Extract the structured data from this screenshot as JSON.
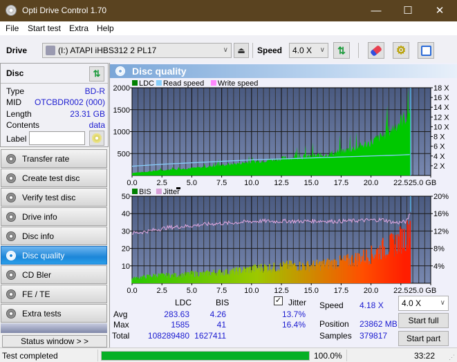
{
  "window": {
    "title": "Opti Drive Control 1.70",
    "minimize": "—",
    "maximize": "☐",
    "close": "✕"
  },
  "menu": [
    "File",
    "Start test",
    "Extra",
    "Help"
  ],
  "toolbar": {
    "drive_label": "Drive",
    "drive_value": "(I:)  ATAPI iHBS312   2 PL17",
    "speed_label": "Speed",
    "speed_value": "4.0 X"
  },
  "disc": {
    "header": "Disc",
    "rows": [
      {
        "key": "Type",
        "value": "BD-R"
      },
      {
        "key": "MID",
        "value": "OTCBDR002 (000)"
      },
      {
        "key": "Length",
        "value": "23.31 GB"
      },
      {
        "key": "Contents",
        "value": "data"
      }
    ],
    "label_key": "Label",
    "label_value": ""
  },
  "nav": [
    {
      "label": "Transfer rate",
      "active": false
    },
    {
      "label": "Create test disc",
      "active": false
    },
    {
      "label": "Verify test disc",
      "active": false
    },
    {
      "label": "Drive info",
      "active": false
    },
    {
      "label": "Disc info",
      "active": false
    },
    {
      "label": "Disc quality",
      "active": true
    },
    {
      "label": "CD Bler",
      "active": false
    },
    {
      "label": "FE / TE",
      "active": false
    },
    {
      "label": "Extra tests",
      "active": false
    }
  ],
  "status_window_label": "Status window > >",
  "panel_title": "Disc quality",
  "chart_data": [
    {
      "type": "area",
      "title": "",
      "legend": [
        "LDC",
        "Read speed",
        "Write speed"
      ],
      "legend_colors": [
        "#008000",
        "#87cefa",
        "#ff88ff"
      ],
      "legend_position": "top-left",
      "xlabel": "GB",
      "xlim": [
        0,
        25
      ],
      "xticks": [
        "0.0",
        "2.5",
        "5.0",
        "7.5",
        "10.0",
        "12.5",
        "15.0",
        "17.5",
        "20.0",
        "22.5",
        "25.0 GB"
      ],
      "ylim": [
        0,
        2000
      ],
      "yticks": [
        "2000",
        "1500",
        "1000",
        "500"
      ],
      "y2lim": [
        0,
        18
      ],
      "y2ticks": [
        "18 X",
        "16 X",
        "14 X",
        "12 X",
        "10 X",
        "8 X",
        "6 X",
        "4 X",
        "2 X"
      ],
      "grid": true,
      "series": [
        {
          "name": "LDC",
          "x": [
            0,
            1,
            2,
            3,
            4,
            5,
            6,
            7,
            8,
            9,
            10,
            11,
            12,
            13,
            14,
            15,
            16,
            17,
            18,
            19,
            20,
            21,
            22,
            22.5,
            23,
            23.31
          ],
          "values": [
            60,
            80,
            110,
            130,
            150,
            170,
            190,
            220,
            250,
            280,
            310,
            340,
            370,
            400,
            420,
            440,
            470,
            520,
            580,
            660,
            760,
            900,
            1120,
            1250,
            1350,
            1585
          ]
        },
        {
          "name": "Read speed",
          "x": [
            0,
            2.5,
            5,
            7.5,
            10,
            12.5,
            15,
            17.5,
            20,
            22.5,
            23.31
          ],
          "values": [
            1.9,
            2.3,
            2.6,
            2.9,
            3.2,
            3.4,
            3.6,
            3.8,
            4.0,
            4.2,
            4.3
          ]
        }
      ]
    },
    {
      "type": "bar",
      "title": "",
      "legend": [
        "BIS",
        "Jitter"
      ],
      "legend_colors": [
        "#008000",
        "#d8a0d8"
      ],
      "legend_position": "top-left",
      "xlabel": "GB",
      "xlim": [
        0,
        25
      ],
      "xticks": [
        "0.0",
        "2.5",
        "5.0",
        "7.5",
        "10.0",
        "12.5",
        "15.0",
        "17.5",
        "20.0",
        "22.5",
        "25.0 GB"
      ],
      "ylim": [
        0,
        50
      ],
      "yticks": [
        "50",
        "40",
        "30",
        "20",
        "10"
      ],
      "y2lim": [
        0,
        20
      ],
      "y2ticks": [
        "20%",
        "16%",
        "12%",
        "8%",
        "4%"
      ],
      "grid": true,
      "series": [
        {
          "name": "BIS",
          "x": [
            0,
            1,
            2,
            3,
            4,
            5,
            6,
            7,
            8,
            9,
            10,
            11,
            12,
            13,
            14,
            15,
            16,
            17,
            18,
            19,
            20,
            21,
            22,
            22.5,
            23,
            23.31
          ],
          "values": [
            3,
            4,
            5,
            5,
            5,
            6,
            6,
            7,
            7,
            8,
            9,
            10,
            10,
            11,
            11,
            11,
            12,
            13,
            14,
            16,
            18,
            22,
            25,
            28,
            30,
            41
          ]
        },
        {
          "name": "Jitter",
          "x": [
            0,
            1,
            2,
            3,
            4,
            5,
            6,
            7,
            8,
            9,
            10,
            11,
            12,
            13,
            14,
            15,
            16,
            17,
            18,
            19,
            20,
            21,
            22,
            22.5,
            23,
            23.31
          ],
          "values": [
            11.5,
            11.8,
            12.3,
            12.8,
            13.0,
            13.2,
            13.5,
            13.7,
            13.8,
            14.0,
            14.2,
            14.3,
            14.2,
            14.3,
            14.2,
            14.3,
            14.3,
            14.2,
            14.3,
            14.4,
            14.5,
            14.6,
            13.9,
            14.0,
            14.2,
            16.4
          ]
        }
      ]
    }
  ],
  "stats": {
    "col_ldc": "LDC",
    "col_bis": "BIS",
    "jitter_label": "Jitter",
    "jitter_checked": true,
    "rows": [
      {
        "label": "Avg",
        "ldc": "283.63",
        "bis": "4.26",
        "jitter": "13.7%"
      },
      {
        "label": "Max",
        "ldc": "1585",
        "bis": "41",
        "jitter": "16.4%"
      },
      {
        "label": "Total",
        "ldc": "108289480",
        "bis": "1627411",
        "jitter": ""
      }
    ],
    "speed_label": "Speed",
    "speed_value": "4.18 X",
    "position_label": "Position",
    "position_value": "23862 MB",
    "samples_label": "Samples",
    "samples_value": "379817",
    "speed_select": "4.0 X",
    "start_full": "Start full",
    "start_part": "Start part"
  },
  "statusbar": {
    "text": "Test completed",
    "progress": 100.0,
    "progress_text": "100.0%",
    "time": "33:22"
  }
}
